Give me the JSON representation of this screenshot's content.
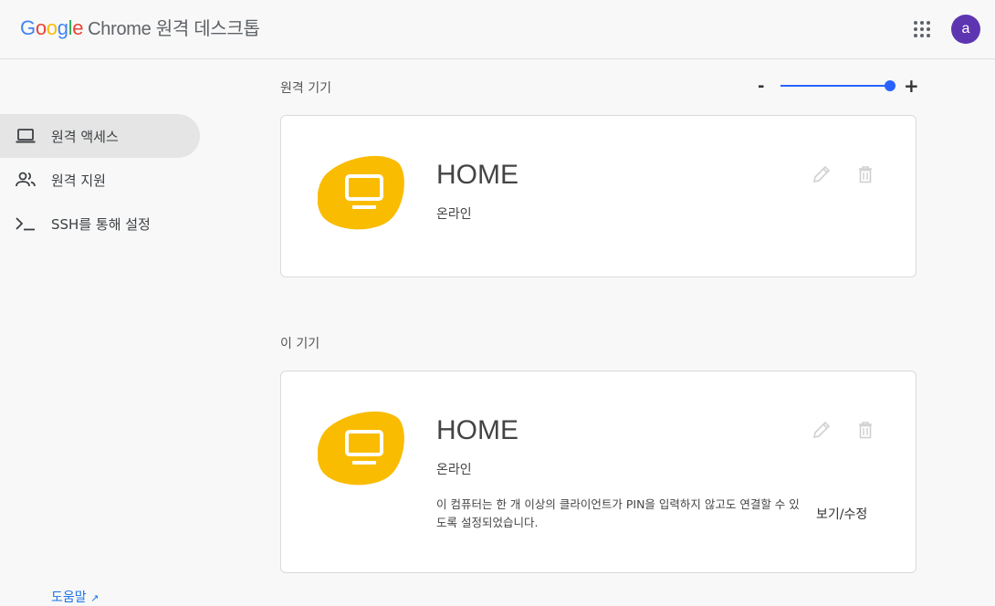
{
  "header": {
    "logo_letters": [
      "G",
      "o",
      "o",
      "g",
      "l",
      "e"
    ],
    "app_title": "Chrome 원격 데스크톱",
    "apps_icon": "apps-grid-icon",
    "avatar_letter": "a"
  },
  "sidebar": {
    "items": [
      {
        "label": "원격 액세스",
        "icon": "laptop-icon",
        "active": true
      },
      {
        "label": "원격 지원",
        "icon": "people-icon",
        "active": false
      },
      {
        "label": "SSH를 통해 설정",
        "icon": "terminal-icon",
        "active": false
      }
    ],
    "help_label": "도움말"
  },
  "main": {
    "remote_section_title": "원격 기기",
    "zoom": {
      "minus": "-",
      "plus": "+",
      "level": 1.0
    },
    "this_section_title": "이 기기",
    "remote_device": {
      "name": "HOME",
      "status": "온라인"
    },
    "this_device": {
      "name": "HOME",
      "status": "온라인",
      "description": "이 컴퓨터는 한 개 이상의 클라이언트가 PIN을 입력하지 않고도 연결할 수 있도록 설정되었습니다.",
      "view_edit": "보기/수정"
    }
  },
  "colors": {
    "accent": "#2962ff",
    "blob": "#f9bc00",
    "avatar": "#5e35b1",
    "active_nav": "#e5e5e5"
  }
}
